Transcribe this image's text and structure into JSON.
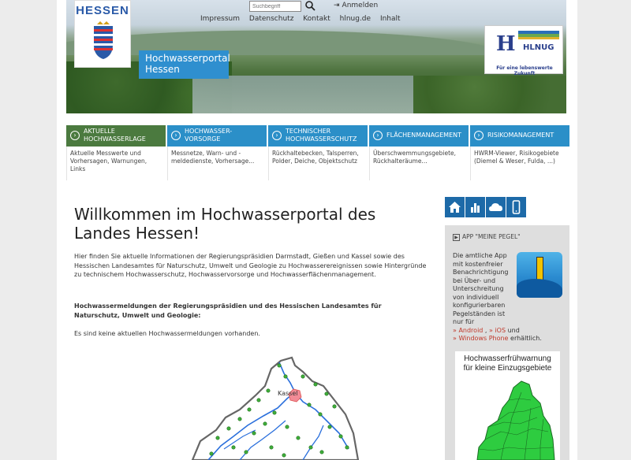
{
  "header": {
    "logo_text": "HESSEN",
    "portal_title_line1": "Hochwasserportal",
    "portal_title_line2": "Hessen",
    "search_placeholder": "Suchbegriff",
    "login_label": "Anmelden",
    "nav": [
      "Impressum",
      "Datenschutz",
      "Kontakt",
      "hlnug.de",
      "Inhalt"
    ],
    "hlnug_tagline": "Für eine lebenswerte Zukunft",
    "hlnug_text": "HLNUG"
  },
  "tabs": [
    {
      "title_line1": "AKTUELLE",
      "title_line2": "HOCHWASSERLAGE",
      "sub": "Aktuelle Messwerte und Vorhersagen, Warnungen, Links",
      "active": true
    },
    {
      "title_line1": "HOCHWASSER-",
      "title_line2": "VORSORGE",
      "sub": "Messnetze, Warn- und -meldedienste, Vorhersage...",
      "active": false
    },
    {
      "title_line1": "TECHNISCHER",
      "title_line2": "HOCHWASSERSCHUTZ",
      "sub": "Rückhaltebecken, Talsperren, Polder, Deiche, Objektschutz",
      "active": false
    },
    {
      "title_line1": "FLÄCHENMANAGEMENT",
      "title_line2": "",
      "sub": "Überschwemmungsgebiete, Rückhalteräume...",
      "active": false
    },
    {
      "title_line1": "RISIKOMANAGEMENT",
      "title_line2": "",
      "sub": "HWRM-Viewer, Risikogebiete (Diemel & Weser, Fulda, ...)",
      "active": false
    }
  ],
  "main": {
    "heading": "Willkommen im Hochwasserportal des Landes Hessen!",
    "intro": "Hier finden Sie aktuelle Informationen der Regierungspräsidien Darmstadt, Gießen und Kassel sowie des Hessischen Landesamtes für Naturschutz, Umwelt und Geologie zu Hochwasserereignissen sowie Hintergründe zu technischem Hochwasserschutz, Hochwasservorsorge und Hochwasserflächenmanagement.",
    "notices_heading": "Hochwassermeldungen der Regierungspräsidien und des Hessischen Landesamtes für Naturschutz, Umwelt und Geologie:",
    "no_notices": "Es sind keine aktuellen Hochwassermeldungen vorhanden.",
    "map_city": "Kassel"
  },
  "sidebar": {
    "icons": [
      "home-icon",
      "chart-icon",
      "cloud-icon",
      "mobile-icon"
    ],
    "app_title": "APP \"MEINE PEGEL\"",
    "app_text_1": "Die amtliche App mit kostenfreier Benachrichtigung bei Über- und Unterschreitung von individuell konfigurierbaren Pegelständen ist nur für",
    "link_android": "» Android",
    "link_ios": "» iOS",
    "word_und": "und",
    "link_windows": "» Windows Phone",
    "app_text_2": "erhältlich.",
    "warn_title_line1": "Hochwasserfrühwarnung",
    "warn_title_line2": "für kleine Einzugsgebiete"
  },
  "colors": {
    "tab_blue": "#2b8fc8",
    "tab_active_green": "#4b7a3f",
    "portal_badge": "#2f8fcf",
    "sidebar_icon_blue": "#1d6aa8",
    "link_red": "#c0392b",
    "warn_map_green": "#2ecc40"
  }
}
